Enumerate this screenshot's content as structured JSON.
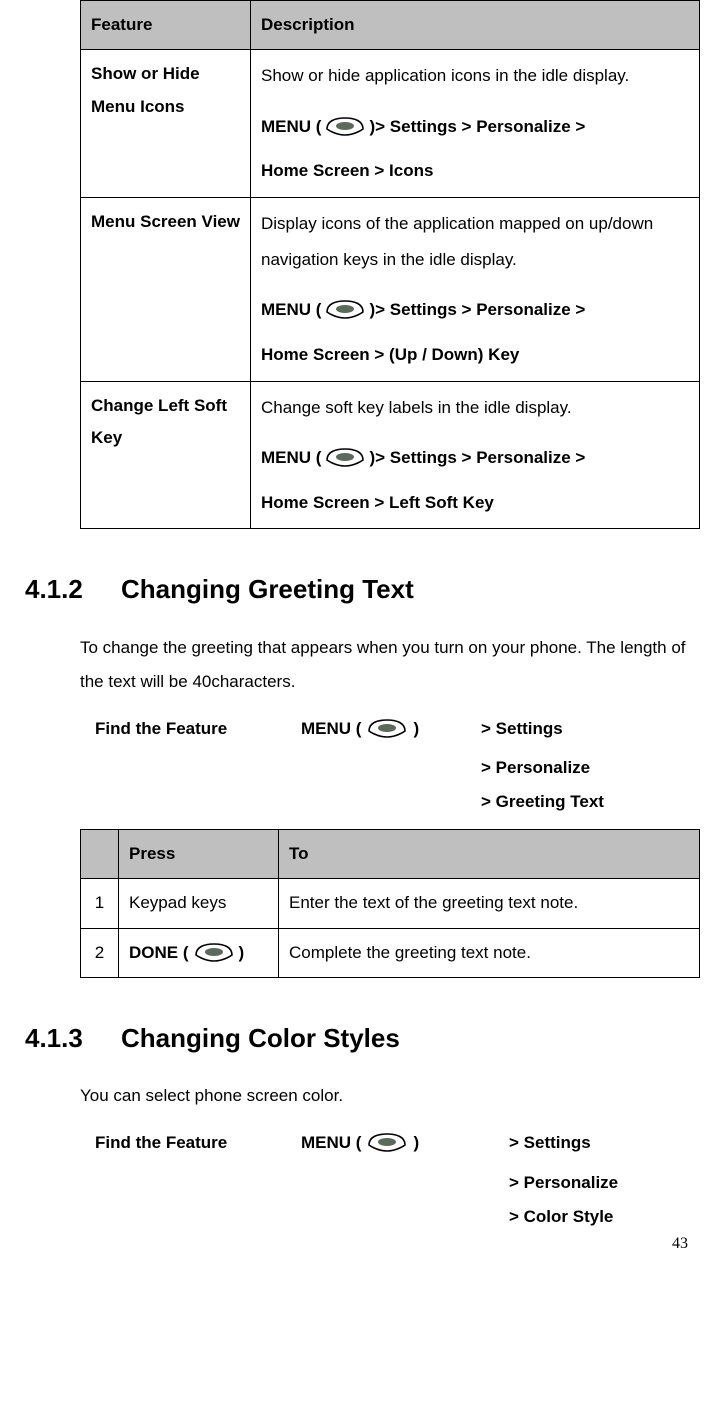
{
  "table1": {
    "headers": {
      "feature": "Feature",
      "description": "Description"
    },
    "rows": [
      {
        "feature": "Show or Hide Menu Icons",
        "desc": "Show or hide application icons in the idle display.",
        "menu_prefix": "MENU (",
        "menu_suffix": ")",
        "path1": " > Settings > Personalize >",
        "path2": "Home Screen > Icons"
      },
      {
        "feature": "Menu Screen View",
        "desc": "Display icons of the application mapped on up/down navigation keys in the idle display.",
        "menu_prefix": "MENU (",
        "menu_suffix": ")",
        "path1": " > Settings > Personalize >",
        "path2": "Home Screen > (Up / Down) Key"
      },
      {
        "feature": "Change Left Soft Key",
        "desc": "Change soft key labels in the idle display.",
        "menu_prefix": "MENU (",
        "menu_suffix": ")",
        "path1": " > Settings > Personalize >",
        "path2": "Home Screen > Left Soft Key"
      }
    ]
  },
  "section1": {
    "number": "4.1.2",
    "title": "Changing Greeting Text",
    "para": "To change the greeting that appears when you turn on your phone. The length of the text will be 40characters.",
    "find_label": "Find the Feature",
    "menu_text": "MENU (",
    "menu_close": ")",
    "step1": "> Settings",
    "step2": "> Personalize",
    "step3": "> Greeting Text"
  },
  "table2": {
    "headers": {
      "n": "",
      "press": "Press",
      "to": "To"
    },
    "rows": [
      {
        "n": "1",
        "press": "Keypad keys",
        "to": "Enter the text of the greeting text note."
      },
      {
        "n": "2",
        "press_prefix": "DONE (",
        "press_suffix": ")",
        "to": "Complete the greeting text note."
      }
    ]
  },
  "section2": {
    "number": "4.1.3",
    "title": "Changing Color Styles",
    "para": "You can select phone screen color.",
    "find_label": "Find the Feature",
    "menu_text": "MENU (",
    "menu_close": ")",
    "step1": "> Settings",
    "step2": "> Personalize",
    "step3": "> Color Style"
  },
  "page_number": "43"
}
